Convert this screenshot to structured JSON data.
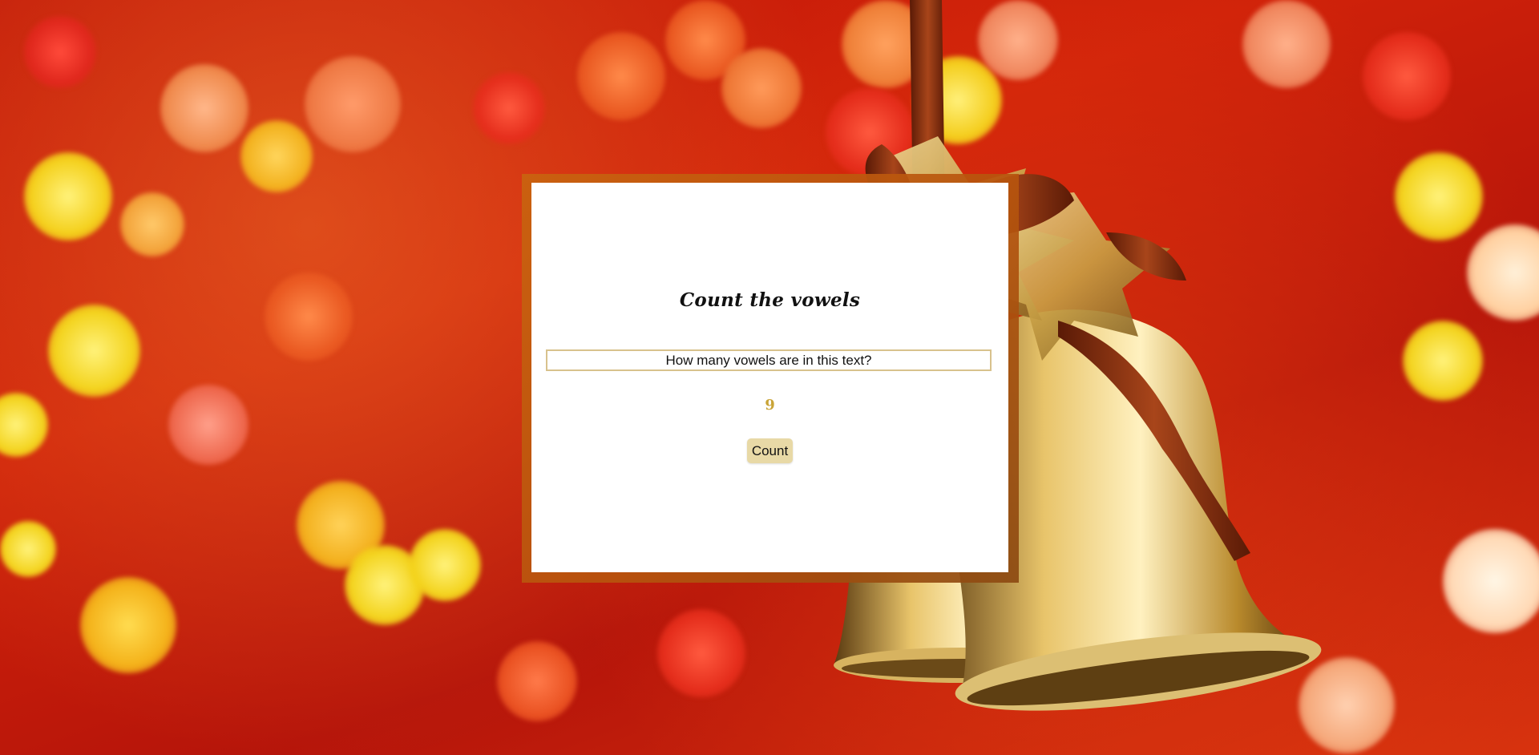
{
  "background": {
    "theme": "red-bokeh-with-golden-christmas-bells",
    "colors": {
      "base": "#c31808",
      "frame": "#c9630f",
      "gold": "#d4a441"
    }
  },
  "card": {
    "title": "Count the vowels",
    "input_value": "How many vowels are in this text?",
    "result": "9",
    "button_label": "Count",
    "colors": {
      "input_border": "#d8c28d",
      "result": "#c9a437",
      "button_bg": "#e8d9a6"
    }
  }
}
